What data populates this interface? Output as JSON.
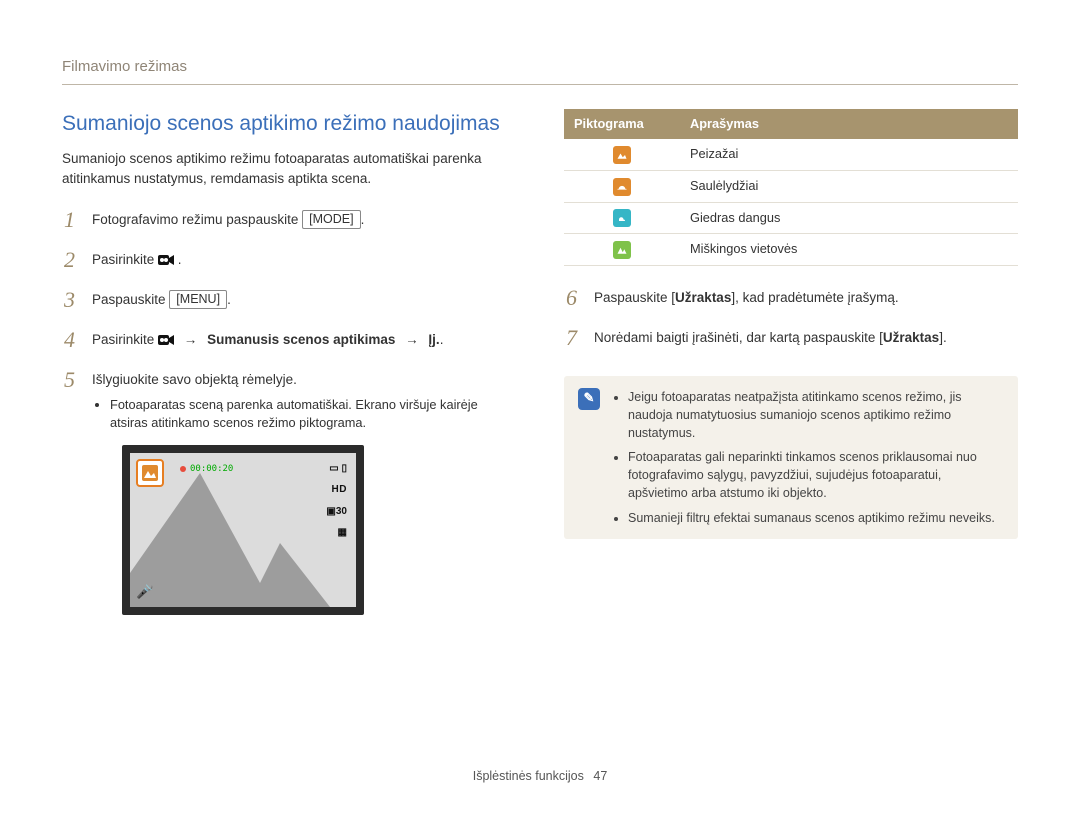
{
  "section_label": "Filmavimo režimas",
  "title": "Sumaniojo scenos aptikimo režimo naudojimas",
  "intro": "Sumaniojo scenos aptikimo režimu fotoaparatas automatiškai parenka atitinkamus nustatymus, remdamasis aptikta scena.",
  "steps_left": {
    "s1_a": "Fotografavimo režimu paspauskite ",
    "s1_btn": "MODE",
    "s1_b": ".",
    "s2_a": "Pasirinkite ",
    "s2_b": ".",
    "s3_a": "Paspauskite ",
    "s3_btn": "MENU",
    "s3_b": ".",
    "s4_a": "Pasirinkite ",
    "s4_bold": "Sumanusis scenos aptikimas",
    "s4_on": "Įj.",
    "s4_b": ".",
    "s5": "Išlygiuokite savo objektą rėmelyje.",
    "s5_sub": "Fotoaparatas sceną parenka automatiškai. Ekrano viršuje kairėje atsiras atitinkamo scenos režimo piktograma."
  },
  "preview": {
    "time": "00:00:20",
    "hd": "HD",
    "fps": "30",
    "rec_dot_title": "recording-indicator"
  },
  "table": {
    "h1": "Piktograma",
    "h2": "Aprašymas",
    "rows": [
      {
        "label": "Peizažai",
        "color": "orange",
        "icon": "landscape-icon"
      },
      {
        "label": "Saulėlydžiai",
        "color": "orange",
        "icon": "sunset-icon"
      },
      {
        "label": "Giedras dangus",
        "color": "blue",
        "icon": "sky-icon"
      },
      {
        "label": "Miškingos vietovės",
        "color": "green",
        "icon": "forest-icon"
      }
    ]
  },
  "steps_right": {
    "s6_a": "Paspauskite [",
    "s6_bold": "Užraktas",
    "s6_b": "], kad pradėtumėte įrašymą.",
    "s7_a": "Norėdami baigti įrašinėti, dar kartą paspauskite [",
    "s7_bold": "Užraktas",
    "s7_b": "]."
  },
  "info": {
    "items": [
      "Jeigu fotoaparatas neatpažįsta atitinkamo scenos režimo, jis naudoja numatytuosius sumaniojo scenos aptikimo režimo nustatymus.",
      "Fotoaparatas gali neparinkti tinkamos scenos priklausomai nuo fotografavimo sąlygų, pavyzdžiui, sujudėjus fotoaparatui, apšvietimo arba atstumo iki objekto.",
      "Sumanieji filtrų efektai sumanaus scenos aptikimo režimu neveiks."
    ]
  },
  "footer": {
    "label": "Išplėstinės funkcijos",
    "page": "47"
  }
}
